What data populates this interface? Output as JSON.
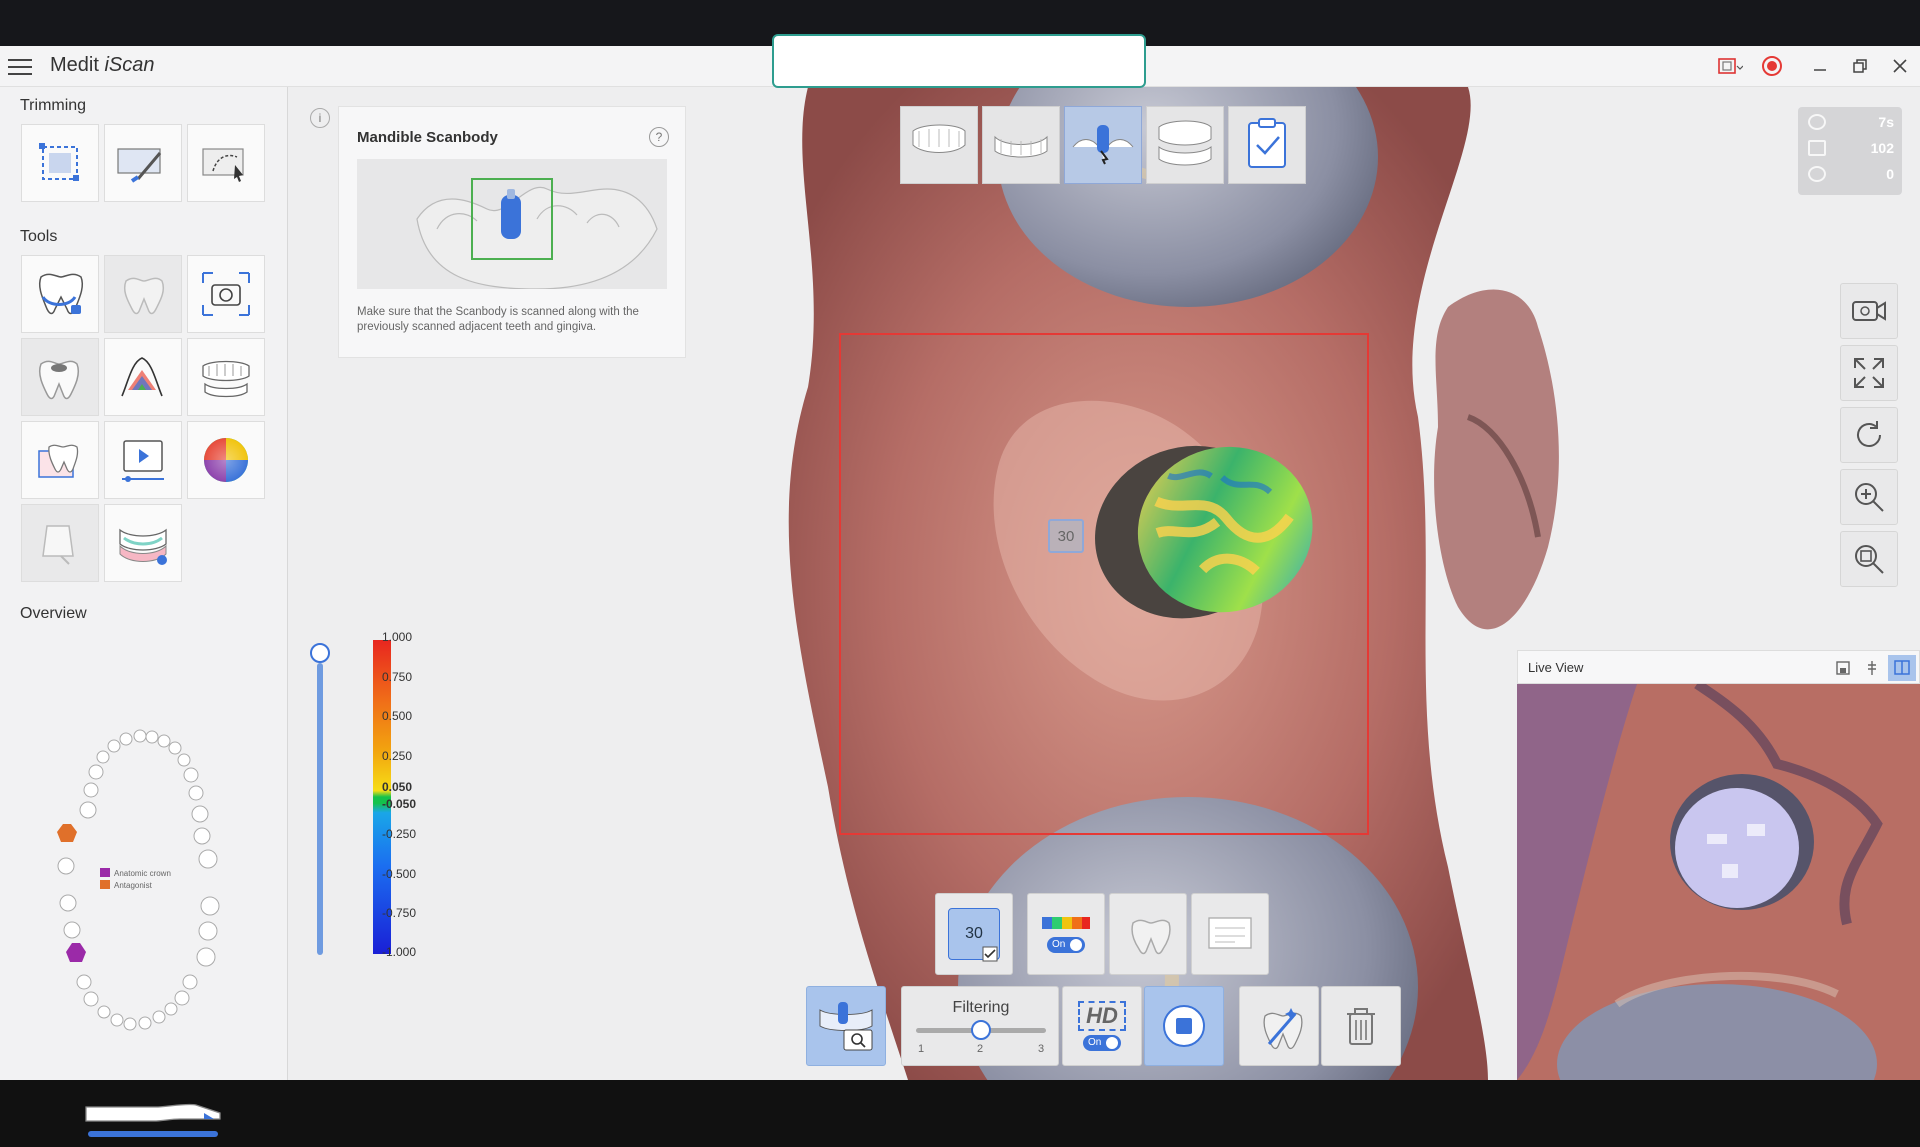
{
  "app": {
    "title_prefix": "Medit ",
    "title_italic": "iScan"
  },
  "left_panel": {
    "trimming_label": "Trimming",
    "tools_label": "Tools",
    "overview_label": "Overview",
    "legend": [
      {
        "label": "Anatomic crown",
        "color": "#9b2aa8"
      },
      {
        "label": "Antagonist",
        "color": "#e0702a"
      }
    ]
  },
  "scan_stage_info": {
    "title": "Mandible Scanbody",
    "help": "?",
    "info": "i",
    "description": "Make sure that the Scanbody is scanned along with the previously scanned adjacent teeth and gingiva."
  },
  "color_scale": {
    "labels": [
      "1.000",
      "0.750",
      "0.500",
      "0.250",
      "0.050",
      "-0.050",
      "-0.250",
      "-0.500",
      "-0.750",
      "-1.000"
    ]
  },
  "stats": {
    "time": "7s",
    "frames": "102",
    "rotations": "0"
  },
  "scene": {
    "tooth_number": "30"
  },
  "live_view": {
    "title": "Live View"
  },
  "bottom_toolbar": {
    "scanbody_number": "30",
    "deviation_toggle": "On",
    "filtering_label": "Filtering",
    "filtering_ticks": [
      "1",
      "2",
      "3"
    ],
    "filtering_value": 2,
    "hd_label": "HD",
    "hd_toggle": "On"
  },
  "colors": {
    "accent_blue": "#3b73d9",
    "selection_red": "#e53935",
    "active_button": "#a9c4ec",
    "gingiva": "#b56d66"
  }
}
